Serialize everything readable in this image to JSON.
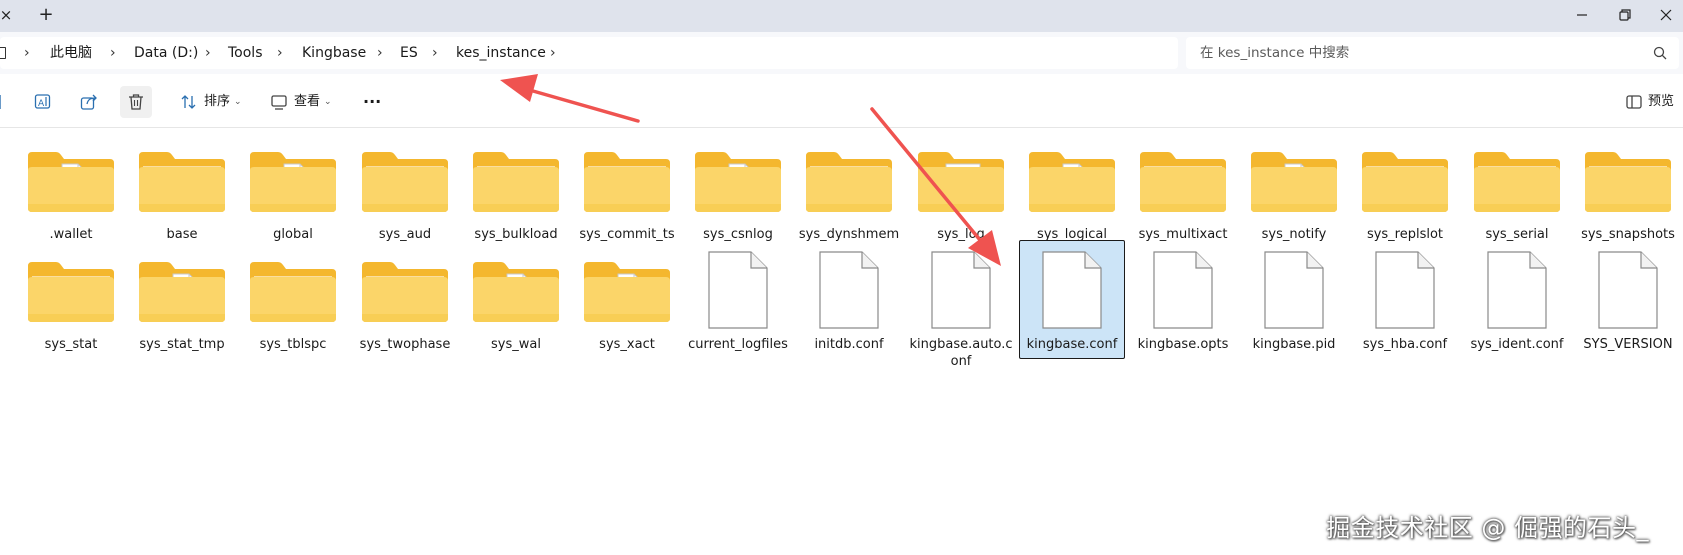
{
  "titlebar": {
    "tab_close": "×",
    "new_tab": "+",
    "minimize": "—",
    "maximize": "❐",
    "close": "✕"
  },
  "address": {
    "crumbs": [
      "此电脑",
      "Data (D:)",
      "Tools",
      "Kingbase",
      "ES",
      "kes_instance"
    ],
    "separator": "›"
  },
  "search": {
    "placeholder": "在 kes_instance 中搜索"
  },
  "toolbar": {
    "sort_label": "排序",
    "view_label": "查看",
    "more_label": "···",
    "preview_label": "预览",
    "caret": "⌄"
  },
  "items": [
    {
      "name": ".wallet",
      "type": "folder-doc"
    },
    {
      "name": "base",
      "type": "folder"
    },
    {
      "name": "global",
      "type": "folder-doc"
    },
    {
      "name": "sys_aud",
      "type": "folder"
    },
    {
      "name": "sys_bulkload",
      "type": "folder"
    },
    {
      "name": "sys_commit_ts",
      "type": "folder"
    },
    {
      "name": "sys_csnlog",
      "type": "folder-doc"
    },
    {
      "name": "sys_dynshmem",
      "type": "folder"
    },
    {
      "name": "sys_log",
      "type": "folder-list"
    },
    {
      "name": "sys_logical",
      "type": "folder-doc"
    },
    {
      "name": "sys_multixact",
      "type": "folder"
    },
    {
      "name": "sys_notify",
      "type": "folder-doc"
    },
    {
      "name": "sys_replslot",
      "type": "folder"
    },
    {
      "name": "sys_serial",
      "type": "folder"
    },
    {
      "name": "sys_snapshots",
      "type": "folder"
    },
    {
      "name": "sys_stat",
      "type": "folder"
    },
    {
      "name": "sys_stat_tmp",
      "type": "folder-doc"
    },
    {
      "name": "sys_tblspc",
      "type": "folder"
    },
    {
      "name": "sys_twophase",
      "type": "folder"
    },
    {
      "name": "sys_wal",
      "type": "folder-doc"
    },
    {
      "name": "sys_xact",
      "type": "folder-doc"
    },
    {
      "name": "current_logfiles",
      "type": "file"
    },
    {
      "name": "initdb.conf",
      "type": "file"
    },
    {
      "name": "kingbase.auto.conf",
      "type": "file"
    },
    {
      "name": "kingbase.conf",
      "type": "file",
      "selected": true
    },
    {
      "name": "kingbase.opts",
      "type": "file"
    },
    {
      "name": "kingbase.pid",
      "type": "file"
    },
    {
      "name": "sys_hba.conf",
      "type": "file"
    },
    {
      "name": "sys_ident.conf",
      "type": "file"
    },
    {
      "name": "SYS_VERSION",
      "type": "file"
    }
  ],
  "watermark": "掘金技术社区 @ 倔强的石头_",
  "colors": {
    "folder_back": "#f4b72e",
    "folder_front": "#fbd569",
    "selection": "#cce4f7",
    "arrow": "#ef5350",
    "titlebar": "#dfe3ec"
  }
}
